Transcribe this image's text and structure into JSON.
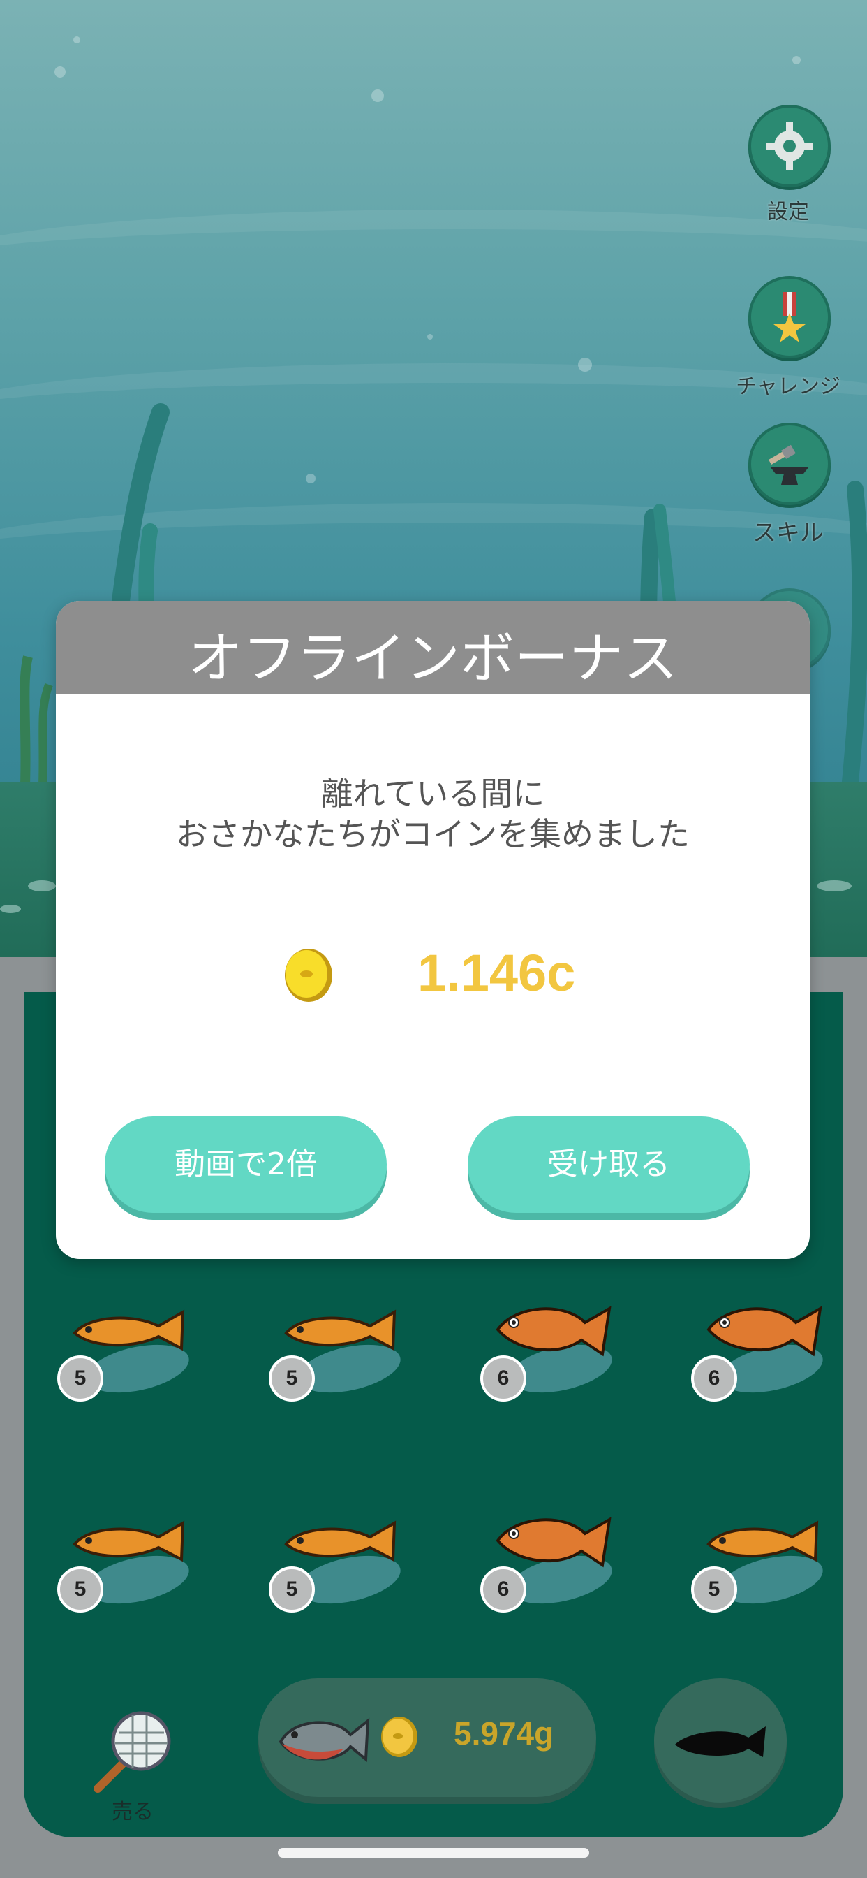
{
  "side_menu": [
    {
      "label": "設定",
      "icon": "gear-icon"
    },
    {
      "label": "チャレンジ",
      "icon": "medal-icon"
    },
    {
      "label": "スキル",
      "icon": "anvil-icon"
    }
  ],
  "dialog": {
    "title": "オフラインボーナス",
    "message_line1": "離れている間に",
    "message_line2": "おさかなたちがコインを集めました",
    "reward_amount": "1.146c",
    "double_button": "動画で2倍",
    "receive_button": "受け取る"
  },
  "fish_grid": {
    "row1": [
      "5",
      "5",
      "6",
      "6"
    ],
    "row2": [
      "5",
      "5",
      "6",
      "5"
    ]
  },
  "bottom_bar": {
    "sell_label": "売る",
    "buy_price": "5.974g"
  },
  "colors": {
    "accent": "#62d8c4",
    "coin": "#f2c640",
    "tank": "#055b4a"
  }
}
